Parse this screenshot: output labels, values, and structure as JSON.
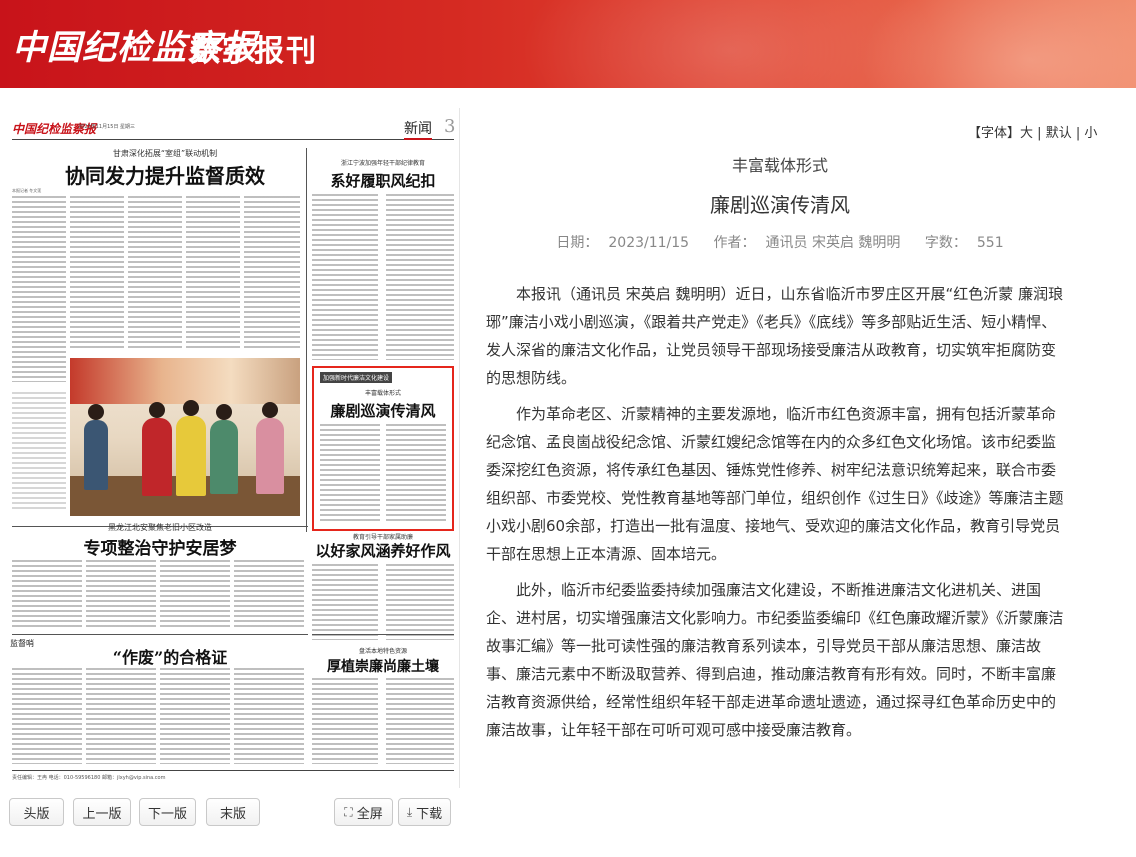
{
  "header": {
    "logo": "中国纪检监察报",
    "subtitle": "数字报刊"
  },
  "paper": {
    "masthead": "中国纪检监察报",
    "date": "2023年11月15日 星期三",
    "section": "新闻",
    "page_number": "3",
    "stories": [
      {
        "kicker": "甘肃深化拓展“室组”联动机制",
        "headline": "协同发力提升监督质效",
        "byline": "本报记者 冬文莲"
      },
      {
        "kicker": "浙江宁波加强年轻干部纪律教育",
        "headline": "系好履职风纪扣"
      },
      {
        "tag": "加强新时代廉洁文化建设",
        "kicker": "丰富载体形式",
        "headline": "廉剧巡演传清风"
      },
      {
        "kicker": "黑龙江北安聚焦老旧小区改造",
        "headline": "专项整治守护安居梦"
      },
      {
        "kicker": "教育引导干部家属助廉",
        "headline": "以好家风涵养好作风"
      },
      {
        "column": "监督哨",
        "headline": "“作废”的合格证"
      },
      {
        "kicker": "盘活本地特色资源",
        "headline": "厚植崇廉尚廉土壤"
      }
    ],
    "footer": "责任编辑：王冉  电话：010-59596180  邮箱：jlxyh@vip.sina.com"
  },
  "pager": {
    "first": "头版",
    "prev": "上一版",
    "next": "下一版",
    "last": "末版",
    "fullscreen": "全屏",
    "download": "下载"
  },
  "font_controls": {
    "label": "【字体】",
    "large": "大",
    "sep1": " | ",
    "default": "默认",
    "sep2": " | ",
    "small": "小"
  },
  "article": {
    "subtitle": "丰富载体形式",
    "title": "廉剧巡演传清风",
    "date_label": "日期：",
    "date": "2023/11/15",
    "author_label": "作者：",
    "author": "通讯员 宋英启 魏明明",
    "words_label": "字数：",
    "words": "551",
    "paragraphs": [
      "本报讯（通讯员 宋英启 魏明明）近日，山东省临沂市罗庄区开展“红色沂蒙 廉润琅琊”廉洁小戏小剧巡演，《跟着共产党走》《老兵》《底线》等多部贴近生活、短小精悍、发人深省的廉洁文化作品，让党员领导干部现场接受廉洁从政教育，切实筑牢拒腐防变的思想防线。",
      "作为革命老区、沂蒙精神的主要发源地，临沂市红色资源丰富，拥有包括沂蒙革命纪念馆、孟良崮战役纪念馆、沂蒙红嫂纪念馆等在内的众多红色文化场馆。该市纪委监委深挖红色资源，将传承红色基因、锤炼党性修养、树牢纪法意识统筹起来，联合市委组织部、市委党校、党性教育基地等部门单位，组织创作《过生日》《歧途》等廉洁主题小戏小剧60余部，打造出一批有温度、接地气、受欢迎的廉洁文化作品，教育引导党员干部在思想上正本清源、固本培元。",
      "此外，临沂市纪委监委持续加强廉洁文化建设，不断推进廉洁文化进机关、进国企、进村居，切实增强廉洁文化影响力。市纪委监委编印《红色廉政耀沂蒙》《沂蒙廉洁故事汇编》等一批可读性强的廉洁教育系列读本，引导党员干部从廉洁思想、廉洁故事、廉洁元素中不断汲取营养、得到启迪，推动廉洁教育有形有效。同时，不断丰富廉洁教育资源供给，经常性组织年轻干部走进革命遗址遗迹，通过探寻红色革命历史中的廉洁故事，让年轻干部在可听可观可感中接受廉洁教育。"
    ]
  },
  "colors": {
    "brand_red": "#c8131a",
    "highlight_border": "#e5261c"
  }
}
